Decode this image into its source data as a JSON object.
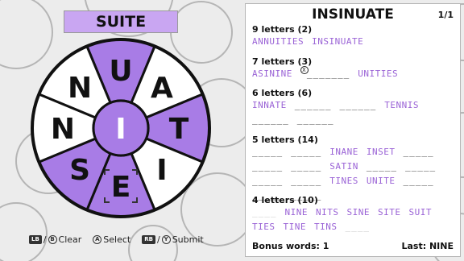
{
  "current_word": "SUITE",
  "wheel": {
    "center_letter": "I",
    "slices": [
      {
        "letter": "U",
        "highlighted": true
      },
      {
        "letter": "A",
        "highlighted": false
      },
      {
        "letter": "T",
        "highlighted": true
      },
      {
        "letter": "I",
        "highlighted": false
      },
      {
        "letter": "E",
        "highlighted": true,
        "selected": true
      },
      {
        "letter": "S",
        "highlighted": true
      },
      {
        "letter": "N",
        "highlighted": false
      },
      {
        "letter": "N",
        "highlighted": false
      }
    ]
  },
  "controls": {
    "clear": {
      "icon1": "LB",
      "icon2": "B",
      "label": "Clear"
    },
    "select": {
      "icon": "A",
      "label": "Select"
    },
    "submit": {
      "icon1": "RB",
      "icon2": "Y",
      "label": "Submit"
    }
  },
  "panel": {
    "title": "INSINUATE",
    "page": "1/1",
    "sections": [
      {
        "head": "9 letters (2)",
        "items": [
          {
            "t": "word",
            "v": "ANNUITIES"
          },
          {
            "t": "word",
            "v": "INSINUATE"
          }
        ]
      },
      {
        "head": "7 letters (3)",
        "items": [
          {
            "t": "word",
            "v": "ASININE"
          },
          {
            "t": "blank_hint",
            "v": "_______",
            "hint": "X"
          },
          {
            "t": "word",
            "v": "UNITIES"
          }
        ]
      },
      {
        "head": "6 letters (6)",
        "items": [
          {
            "t": "word",
            "v": "INNATE"
          },
          {
            "t": "blank",
            "v": "______"
          },
          {
            "t": "blank",
            "v": "______"
          },
          {
            "t": "word",
            "v": "TENNIS"
          },
          {
            "t": "blank",
            "v": "______"
          },
          {
            "t": "blank",
            "v": "______"
          }
        ]
      },
      {
        "head": "5 letters (14)",
        "items": [
          {
            "t": "blank",
            "v": "_____"
          },
          {
            "t": "blank",
            "v": "_____"
          },
          {
            "t": "word",
            "v": "INANE"
          },
          {
            "t": "word",
            "v": "INSET"
          },
          {
            "t": "blank",
            "v": "_____"
          },
          {
            "t": "blank",
            "v": "_____"
          },
          {
            "t": "blank",
            "v": "_____"
          },
          {
            "t": "word",
            "v": "SATIN"
          },
          {
            "t": "blank",
            "v": "_____"
          },
          {
            "t": "blank",
            "v": "_____"
          },
          {
            "t": "blank",
            "v": "_____"
          },
          {
            "t": "blank",
            "v": "_____"
          },
          {
            "t": "word",
            "v": "TINES"
          },
          {
            "t": "word",
            "v": "UNITE"
          },
          {
            "t": "blank",
            "v": "_____"
          },
          {
            "t": "blank",
            "v": "_____"
          },
          {
            "t": "blank",
            "v": "_____"
          }
        ]
      },
      {
        "head": "4 letters (10)",
        "items": [
          {
            "t": "blank_faint",
            "v": "____"
          },
          {
            "t": "word",
            "v": "NINE"
          },
          {
            "t": "word",
            "v": "NITS"
          },
          {
            "t": "word",
            "v": "SINE"
          },
          {
            "t": "word",
            "v": "SITE"
          },
          {
            "t": "word",
            "v": "SUIT"
          },
          {
            "t": "word",
            "v": "TIES"
          },
          {
            "t": "word",
            "v": "TINE"
          },
          {
            "t": "word",
            "v": "TINS"
          },
          {
            "t": "blank_faint",
            "v": "____"
          }
        ]
      }
    ],
    "bonus_label": "Bonus words: 1",
    "last_label": "Last: NINE"
  },
  "colors": {
    "purple": "#a87ce6",
    "purple_light": "#c9a6f2",
    "word_text": "#9a63d6",
    "white": "#ffffff"
  }
}
